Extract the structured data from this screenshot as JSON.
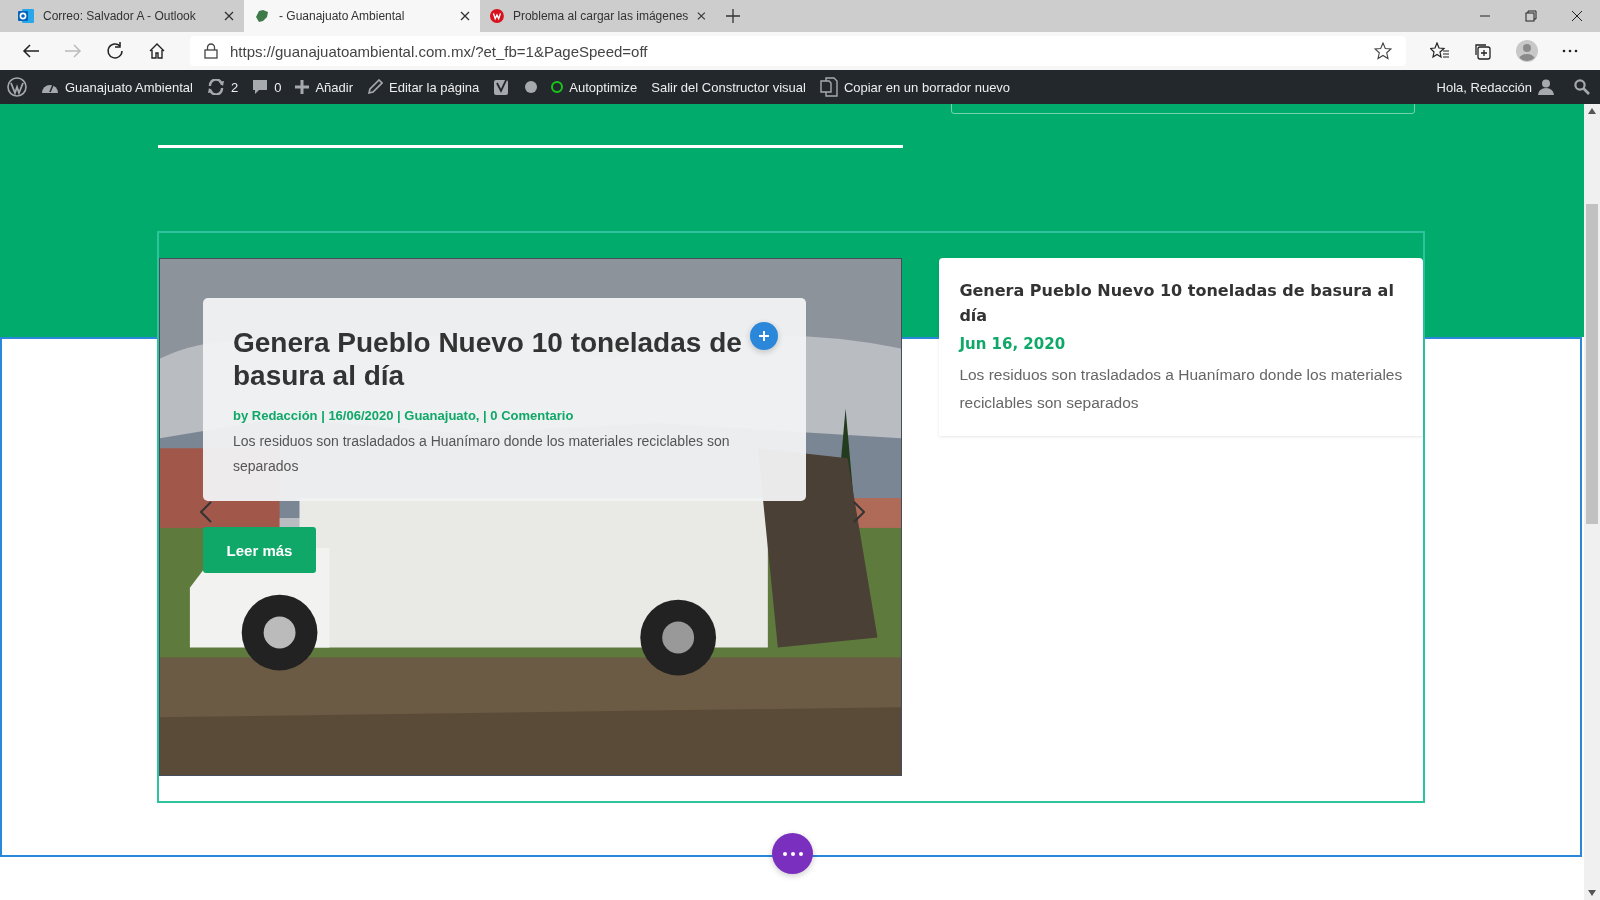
{
  "tabs": [
    {
      "title": "Correo: Salvador A - Outlook",
      "kind": "mail",
      "selected": false
    },
    {
      "title": "- Guanajuato Ambiental",
      "kind": "site",
      "selected": true
    },
    {
      "title": "Problema al cargar las imágenes",
      "kind": "forum",
      "selected": false
    }
  ],
  "address": {
    "url": "https://guanajuatoambiental.com.mx/?et_fb=1&PageSpeed=off"
  },
  "admin_bar": {
    "items": [
      {
        "kind": "site",
        "label": "Guanajuato Ambiental"
      },
      {
        "kind": "updates",
        "label": "2"
      },
      {
        "kind": "comments",
        "label": "0"
      },
      {
        "kind": "add",
        "label": "Añadir"
      },
      {
        "kind": "edit",
        "label": "Editar la página"
      },
      {
        "kind": "seo"
      },
      {
        "kind": "autoptimize",
        "label": "Autoptimize"
      },
      {
        "kind": "plain",
        "label": "Salir del Constructor visual"
      },
      {
        "kind": "copy",
        "label": "Copiar en un borrador nuevo"
      }
    ],
    "greeting": "Hola, Redacción"
  },
  "featured": {
    "title": "Genera Pueblo Nuevo 10 toneladas de basura al día",
    "meta": "by Redacción | 16/06/2020 | Guanajuato, | 0 Comentario",
    "excerpt": "Los residuos son trasladados a Huanímaro donde los materiales reciclables son separados",
    "button": "Leer más"
  },
  "sidebar_post": {
    "title": "Genera Pueblo Nuevo 10 toneladas de basura al día",
    "date": "Jun 16, 2020",
    "excerpt": "Los residuos son trasladados a Huanímaro donde los materiales reciclables son separados"
  }
}
